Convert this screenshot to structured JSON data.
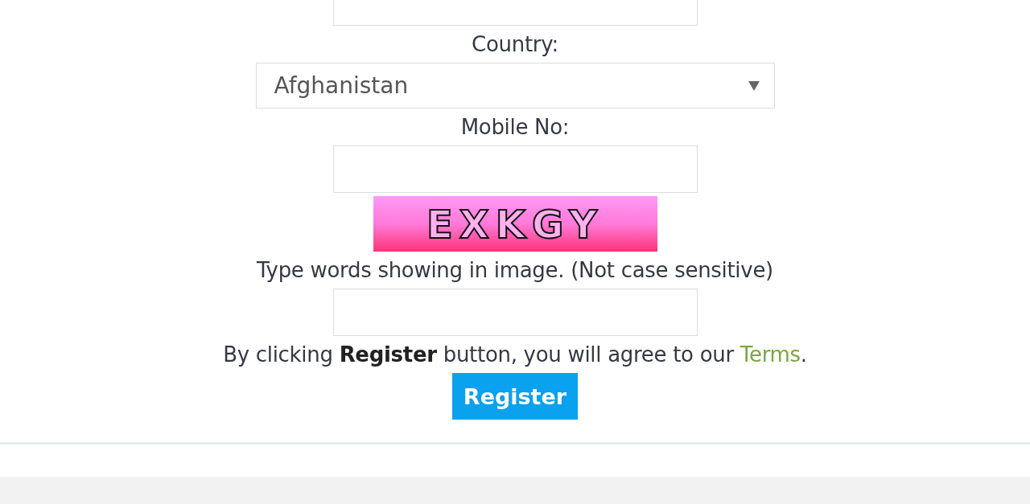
{
  "fields": [
    {
      "kind": "text"
    },
    {
      "kind": "select",
      "label": "Country:",
      "value": "Afghanistan"
    },
    {
      "kind": "text",
      "label": "Mobile No:"
    },
    {
      "kind": "captcha",
      "code": "EXKGY",
      "label": "Type words showing in image. (Not case sensitive)"
    }
  ],
  "agreement": {
    "text": "By clicking **Register** button, you will agree to our ",
    "link": "Terms",
    "end": "."
  },
  "button": "Register"
}
